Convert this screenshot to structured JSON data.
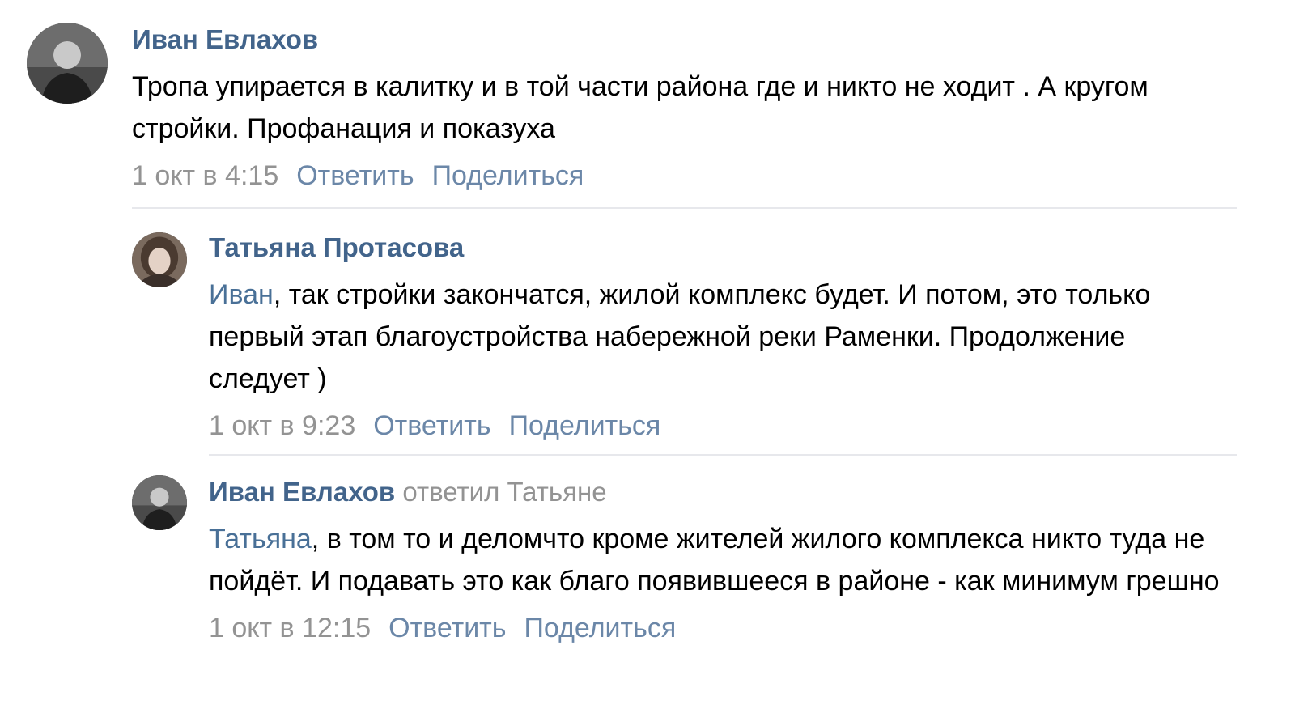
{
  "comments": [
    {
      "author": "Иван Евлахов",
      "replied_to": "",
      "mention": "",
      "text": "Тропа упирается в калитку и в той части района где и никто не ходит . А кругом стройки. Профанация и показуха",
      "date": "1 окт в 4:15",
      "reply_label": "Ответить",
      "share_label": "Поделиться"
    },
    {
      "author": "Татьяна Протасова",
      "replied_to": "",
      "mention": "Иван",
      "text": ", так стройки закончатся, жилой комплекс будет. И потом, это только первый этап благоустройства набережной реки Раменки. Продолжение следует )",
      "date": "1 окт в 9:23",
      "reply_label": "Ответить",
      "share_label": "Поделиться"
    },
    {
      "author": "Иван Евлахов",
      "replied_to": "ответил Татьяне",
      "mention": "Татьяна",
      "text": ", в том то и деломчто кроме жителей жилого комплекса никто туда не пойдёт. И подавать это как благо появившееся в районе - как минимум грешно",
      "date": "1 окт в 12:15",
      "reply_label": "Ответить",
      "share_label": "Поделиться"
    }
  ],
  "icons": {
    "avatar_ivan": "user-photo-icon",
    "avatar_tatyana": "user-photo-icon"
  },
  "colors": {
    "author": "#42648b",
    "link": "#6b87a8",
    "muted": "#939393",
    "divider": "#e7e8ec"
  }
}
